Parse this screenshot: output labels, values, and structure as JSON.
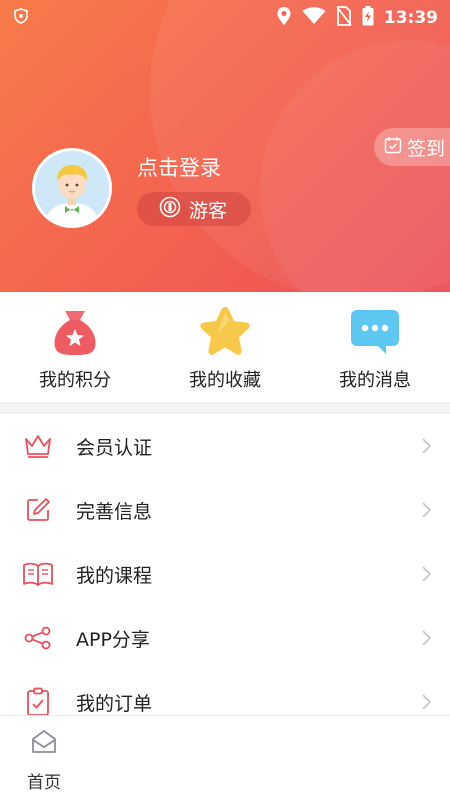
{
  "status_bar": {
    "time": "13:39",
    "icons": [
      "shield-icon",
      "location-icon",
      "wifi-icon",
      "no-sim-icon",
      "battery-charging-icon"
    ]
  },
  "header": {
    "login_prompt": "点击登录",
    "guest_label": "游客",
    "signin_label": "签到"
  },
  "quick_actions": [
    {
      "label": "我的积分",
      "icon": "money-bag-icon"
    },
    {
      "label": "我的收藏",
      "icon": "star-icon"
    },
    {
      "label": "我的消息",
      "icon": "message-icon"
    }
  ],
  "menu": [
    {
      "label": "会员认证",
      "icon": "crown-icon"
    },
    {
      "label": "完善信息",
      "icon": "edit-icon"
    },
    {
      "label": "我的课程",
      "icon": "book-icon"
    },
    {
      "label": "APP分享",
      "icon": "share-icon"
    },
    {
      "label": "我的订单",
      "icon": "clipboard-icon"
    }
  ],
  "tabbar": {
    "home_label": "首页"
  },
  "colors": {
    "header_start": "#f77b4a",
    "header_end": "#ec4e57",
    "icon_accent": "#e8505b",
    "star": "#f7c948",
    "message": "#5cc8f2"
  }
}
